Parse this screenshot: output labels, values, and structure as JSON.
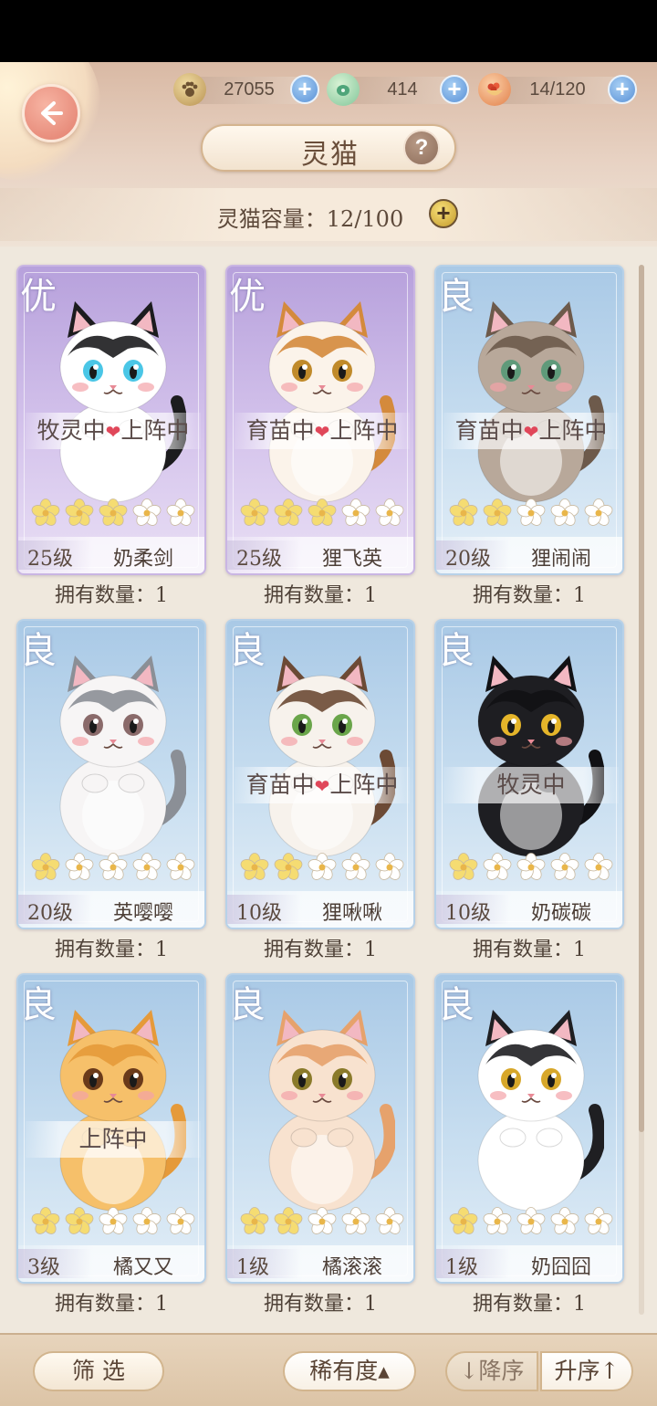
{
  "header": {
    "title": "灵猫",
    "resources": [
      {
        "icon": "paw-coin-icon",
        "value": "27055"
      },
      {
        "icon": "jade-bell-icon",
        "value": "414"
      },
      {
        "icon": "food-bowl-icon",
        "value": "14/120"
      }
    ],
    "capacity_label": "灵猫容量：12/100"
  },
  "cards": [
    {
      "rarity": "优",
      "rarity_class": "r-you",
      "status": "牧灵中♥上阵中",
      "status_parts": [
        "牧灵中",
        "上阵中"
      ],
      "stars": 3,
      "level": "25级",
      "name": "奶柔剑",
      "owned": "拥有数量：1",
      "fur": "#ffffff",
      "patch": "#1c1c1e",
      "eye": "#4ac6e6"
    },
    {
      "rarity": "优",
      "rarity_class": "r-you",
      "status": "育苗中♥上阵中",
      "status_parts": [
        "育苗中",
        "上阵中"
      ],
      "stars": 3,
      "level": "25级",
      "name": "狸飞英",
      "owned": "拥有数量：1",
      "fur": "#fbf3ea",
      "patch": "#d48a3c",
      "eye": "#c08a2a"
    },
    {
      "rarity": "良",
      "rarity_class": "r-liang",
      "status": "育苗中♥上阵中",
      "status_parts": [
        "育苗中",
        "上阵中"
      ],
      "stars": 2,
      "level": "20级",
      "name": "狸闹闹",
      "owned": "拥有数量：1",
      "fur": "#b8a89a",
      "patch": "#6d5a4b",
      "eye": "#5f9a7a"
    },
    {
      "rarity": "良",
      "rarity_class": "r-liang",
      "status": "",
      "status_parts": [],
      "stars": 1,
      "level": "20级",
      "name": "英嘤嘤",
      "owned": "拥有数量：1",
      "fur": "#f7f5f5",
      "patch": "#8b8f96",
      "eye": "#8a6a6a"
    },
    {
      "rarity": "良",
      "rarity_class": "r-liang",
      "status": "育苗中♥上阵中",
      "status_parts": [
        "育苗中",
        "上阵中"
      ],
      "stars": 2,
      "level": "10级",
      "name": "狸啾啾",
      "owned": "拥有数量：1",
      "fur": "#f7f2ec",
      "patch": "#6c4a35",
      "eye": "#6aa54a"
    },
    {
      "rarity": "良",
      "rarity_class": "r-liang",
      "status": "牧灵中",
      "status_parts": [
        "牧灵中"
      ],
      "stars": 1,
      "level": "10级",
      "name": "奶碳碳",
      "owned": "拥有数量：1",
      "fur": "#1e1e22",
      "patch": "#111114",
      "eye": "#e5b52a"
    },
    {
      "rarity": "良",
      "rarity_class": "r-liang",
      "status": "上阵中",
      "status_parts": [
        "上阵中"
      ],
      "stars": 2,
      "level": "3级",
      "name": "橘又又",
      "owned": "拥有数量：1",
      "fur": "#f6c06a",
      "patch": "#e59a3a",
      "eye": "#6a3a1a"
    },
    {
      "rarity": "良",
      "rarity_class": "r-liang",
      "status": "",
      "status_parts": [],
      "stars": 2,
      "level": "1级",
      "name": "橘滚滚",
      "owned": "拥有数量：1",
      "fur": "#f8e2cf",
      "patch": "#e6a26c",
      "eye": "#8a7a2a"
    },
    {
      "rarity": "良",
      "rarity_class": "r-liang",
      "status": "",
      "status_parts": [],
      "stars": 1,
      "level": "1级",
      "name": "奶囧囧",
      "owned": "拥有数量：1",
      "fur": "#ffffff",
      "patch": "#1f1f22",
      "eye": "#d7a72a"
    }
  ],
  "footer": {
    "filter": "筛 选",
    "sort_field": "稀有度▴",
    "desc": "↓降序",
    "asc": "升序↑"
  },
  "colors": {
    "star_on": "#f5dc72",
    "star_off": "#ffffff",
    "heart": "#e0475a"
  }
}
